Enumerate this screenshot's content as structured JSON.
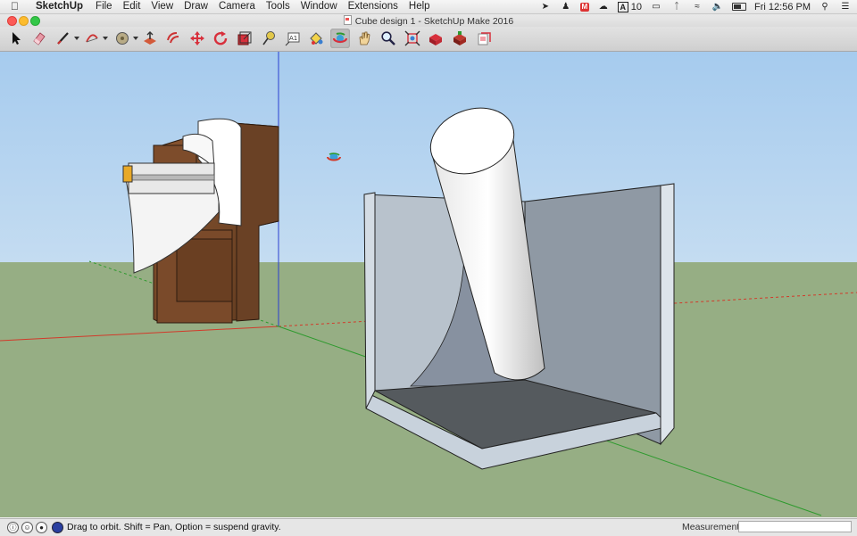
{
  "menubar": {
    "app_name": "SketchUp",
    "items": [
      "File",
      "Edit",
      "View",
      "Draw",
      "Camera",
      "Tools",
      "Window",
      "Extensions",
      "Help"
    ],
    "status": {
      "notification_count": "10",
      "clock": "Fri 12:56 PM"
    }
  },
  "window": {
    "title": "Cube design 1 - SketchUp Make 2016"
  },
  "toolbar": {
    "tools": [
      {
        "name": "select-tool-icon"
      },
      {
        "name": "eraser-tool-icon"
      },
      {
        "name": "line-tool-icon"
      },
      {
        "name": "arc-tool-icon"
      },
      {
        "name": "shapes-tool-icon"
      },
      {
        "name": "push-pull-tool-icon"
      },
      {
        "name": "offset-tool-icon"
      },
      {
        "name": "move-tool-icon"
      },
      {
        "name": "rotate-tool-icon"
      },
      {
        "name": "scale-tool-icon"
      },
      {
        "name": "tape-measure-tool-icon"
      },
      {
        "name": "text-tool-icon"
      },
      {
        "name": "paint-bucket-tool-icon"
      },
      {
        "name": "orbit-tool-icon"
      },
      {
        "name": "pan-tool-icon"
      },
      {
        "name": "zoom-tool-icon"
      },
      {
        "name": "zoom-extents-tool-icon"
      },
      {
        "name": "3d-warehouse-icon"
      },
      {
        "name": "extension-warehouse-icon"
      },
      {
        "name": "send-to-layout-icon"
      }
    ],
    "text_tool_glyph": "A1",
    "active_tool": "orbit-tool-icon"
  },
  "colors": {
    "sky": "#a8cdf0",
    "ground": "#96ae84",
    "axis_red": "#d23a2a",
    "axis_green": "#2e9a2e",
    "axis_blue": "#2a3fd0",
    "wood": "#7a4a2a",
    "panel": "#b9c3cf",
    "floor": "#555a5e"
  },
  "statusbar": {
    "hint": "Drag to orbit. Shift = Pan, Option = suspend gravity.",
    "measurements_label": "Measurements",
    "measurements_value": ""
  }
}
